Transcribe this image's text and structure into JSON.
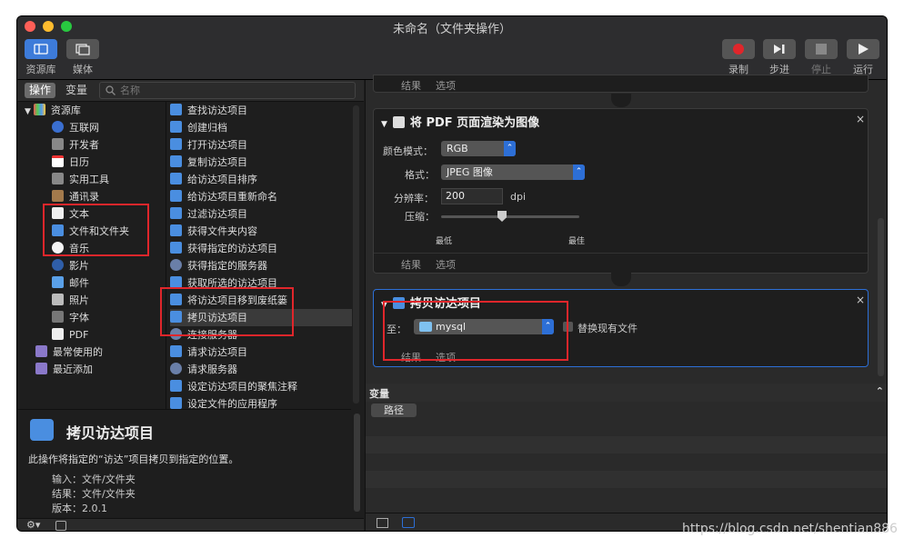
{
  "window": {
    "title": "未命名（文件夹操作）"
  },
  "toolbar": {
    "library_label": "资源库",
    "media_label": "媒体",
    "record_label": "录制",
    "step_label": "步进",
    "stop_label": "停止",
    "run_label": "运行"
  },
  "library_panel": {
    "tab_actions": "操作",
    "tab_variables": "变量",
    "search_placeholder": "名称",
    "library_root": "资源库",
    "categories": [
      "互联网",
      "开发者",
      "日历",
      "实用工具",
      "通讯录",
      "文本",
      "文件和文件夹",
      "音乐",
      "影片",
      "邮件",
      "照片",
      "字体",
      "PDF"
    ],
    "most_used": "最常使用的",
    "recently_added": "最近添加",
    "actions": [
      "查找访达项目",
      "创建归档",
      "打开访达项目",
      "复制访达项目",
      "给访达项目排序",
      "给访达项目重新命名",
      "过滤访达项目",
      "获得文件夹内容",
      "获得指定的访达项目",
      "获得指定的服务器",
      "获取所选的访达项目",
      "将访达项目移到废纸篓",
      "拷贝访达项目",
      "连接服务器",
      "请求访达项目",
      "请求服务器",
      "设定访达项目的聚焦注释",
      "设定文件的应用程序"
    ]
  },
  "description": {
    "title": "拷贝访达项目",
    "text": "此操作将指定的“访达”项目拷贝到指定的位置。",
    "input": "输入：文件/文件夹",
    "result": "结果：文件/文件夹",
    "version": "版本：2.0.1"
  },
  "workflow": {
    "top_card": {
      "results": "结果",
      "options": "选项"
    },
    "pdf_card": {
      "title": "将 PDF 页面渲染为图像",
      "color_mode_label": "颜色模式：",
      "color_mode_value": "RGB",
      "format_label": "格式：",
      "format_value": "JPEG 图像",
      "resolution_label": "分辨率：",
      "resolution_value": "200",
      "resolution_unit": "dpi",
      "compression_label": "压缩：",
      "min_label": "最低",
      "max_label": "最佳",
      "results": "结果",
      "options": "选项"
    },
    "copy_card": {
      "title": "拷贝访达项目",
      "to_label": "至：",
      "folder_value": "mysql",
      "replace_label": "替换现有文件",
      "results": "结果",
      "options": "选项"
    }
  },
  "variables": {
    "header": "变量",
    "path_label": "路径"
  },
  "watermark": "https://blog.csdn.net/shentian886",
  "colors": {
    "highlight_red": "#e0262b",
    "accent_blue": "#2d6fd6",
    "record_red": "#e0262b"
  }
}
